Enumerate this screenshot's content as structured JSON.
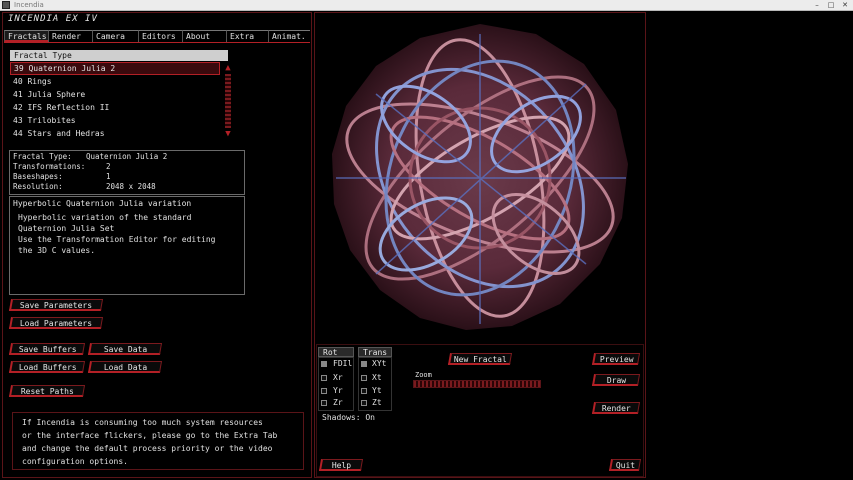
{
  "window": {
    "title": "Incendia",
    "minimize_label": "–",
    "maximize_label": "□",
    "close_label": "✕"
  },
  "app": {
    "name": "INCENDIA EX IV"
  },
  "tabs": [
    "Fractals",
    "Render",
    "Camera",
    "Editors",
    "About",
    "Extra",
    "Animat."
  ],
  "fractal_list": {
    "header": "Fractal Type",
    "items": [
      "39 Quaternion Julia 2",
      "40 Rings",
      "41 Julia Sphere",
      "42 IFS Reflection II",
      "43 Trilobites",
      "44 Stars and Hedras"
    ],
    "selected_index": 0
  },
  "fractal_info": {
    "type_label": "Fractal Type:",
    "type_value": "Quaternion Julia 2",
    "transformations_label": "Transformations:",
    "transformations_value": "2",
    "baseshapes_label": "Baseshapes:",
    "baseshapes_value": "1",
    "resolution_label": "Resolution:",
    "resolution_value": "2048 x 2048"
  },
  "description": {
    "title": "Hyperbolic Quaternion Julia variation",
    "lines": [
      "Hyperbolic variation of the standard",
      "Quaternion Julia Set",
      "Use the Transformation Editor for editing",
      "the 3D C values."
    ]
  },
  "buttons": {
    "save_parameters": "Save Parameters",
    "load_parameters": "Load Parameters",
    "save_buffers": "Save Buffers",
    "save_data": "Save Data",
    "load_buffers": "Load Buffers",
    "load_data": "Load Data",
    "reset_paths": "Reset Paths",
    "new_fractal": "New Fractal",
    "preview": "Preview",
    "draw": "Draw",
    "render": "Render",
    "help": "Help",
    "quit": "Quit"
  },
  "info_text": [
    "If Incendia  is consuming too  much  system resources",
    "or the interface flickers, please go to the Extra Tab",
    "and change the default  process priority or the video",
    "configuration options."
  ],
  "controls": {
    "rot_header": "Rot",
    "trans_header": "Trans",
    "rot_items": [
      {
        "label": "FDIl",
        "checked": true
      },
      {
        "label": "Xr",
        "checked": false
      },
      {
        "label": "Yr",
        "checked": false
      },
      {
        "label": "Zr",
        "checked": false
      }
    ],
    "trans_items": [
      {
        "label": "XYt",
        "checked": true
      },
      {
        "label": "Xt",
        "checked": false
      },
      {
        "label": "Yt",
        "checked": false
      },
      {
        "label": "Zt",
        "checked": false
      }
    ],
    "zoom_label": "Zoom",
    "shadows_label": "Shadows: On"
  },
  "colors": {
    "accent": "#b32026",
    "frame": "#5a1418",
    "background": "#000000"
  }
}
